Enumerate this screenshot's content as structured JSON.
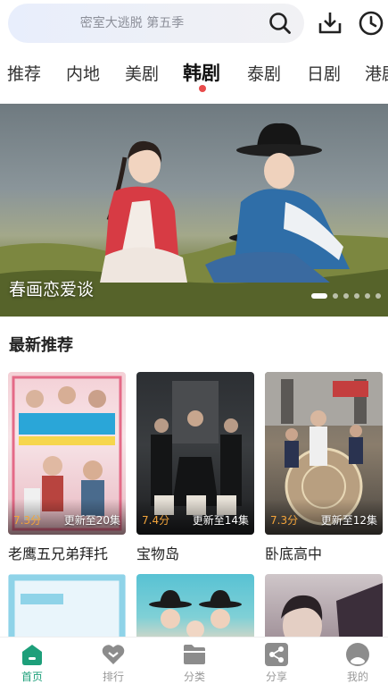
{
  "search": {
    "placeholder": "密室大逃脱 第五季"
  },
  "tabs": [
    {
      "label": "推荐"
    },
    {
      "label": "内地"
    },
    {
      "label": "美剧"
    },
    {
      "label": "韩剧",
      "active": true
    },
    {
      "label": "泰剧"
    },
    {
      "label": "日剧"
    },
    {
      "label": "港剧"
    }
  ],
  "banner": {
    "title": "春画恋爱谈",
    "slide_count": 6,
    "active_slide": 1
  },
  "section": {
    "title": "最新推荐"
  },
  "cards": [
    {
      "title": "老鹰五兄弟拜托",
      "rating": "7.3分",
      "episodes": "更新至20集"
    },
    {
      "title": "宝物岛",
      "rating": "7.4分",
      "episodes": "更新至14集"
    },
    {
      "title": "卧底高中",
      "rating": "7.3分",
      "episodes": "更新至12集"
    }
  ],
  "bottom_nav": [
    {
      "label": "首页",
      "icon": "home-icon",
      "active": true
    },
    {
      "label": "排行",
      "icon": "rank-heart-icon"
    },
    {
      "label": "分类",
      "icon": "folder-icon"
    },
    {
      "label": "分享",
      "icon": "share-icon"
    },
    {
      "label": "我的",
      "icon": "profile-icon"
    }
  ],
  "colors": {
    "accent": "#1d9f7a",
    "tab_dot": "#e84b4b",
    "rating": "#f3a43b"
  }
}
